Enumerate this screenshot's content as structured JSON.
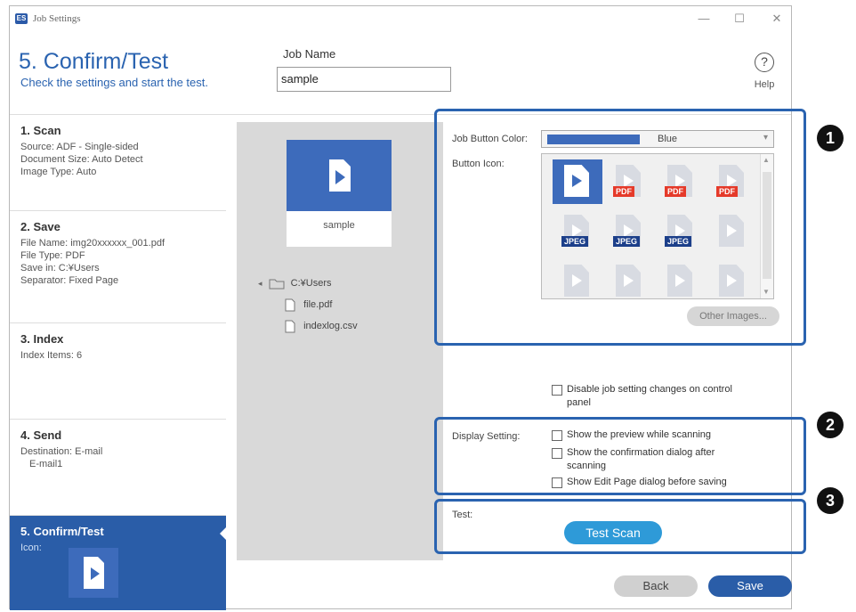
{
  "window": {
    "title": "Job Settings",
    "minimize": "—",
    "maximize": "☐",
    "close": "✕"
  },
  "header": {
    "title": "5. Confirm/Test",
    "subtitle": "Check the settings and start the test.",
    "job_name_label": "Job Name",
    "job_name_value": "sample",
    "help_label": "Help",
    "help_glyph": "?"
  },
  "sidebar": {
    "steps": [
      {
        "name": "1. Scan",
        "lines": [
          "Source: ADF - Single-sided",
          "Document Size: Auto Detect",
          "Image Type: Auto"
        ]
      },
      {
        "name": "2. Save",
        "lines": [
          "File Name: img20xxxxxx_001.pdf",
          "File Type: PDF",
          "Save in: C:¥Users",
          "Separator: Fixed Page"
        ]
      },
      {
        "name": "3. Index",
        "lines": [
          "Index Items: 6"
        ]
      },
      {
        "name": "4. Send",
        "lines": [
          "Destination: E-mail",
          "E-mail1"
        ]
      },
      {
        "name": "5. Confirm/Test",
        "lines": [
          "Icon:"
        ]
      }
    ]
  },
  "preview": {
    "tile_label": "sample",
    "tree": {
      "expand": "◂",
      "folder": "C:¥Users",
      "files": [
        "file.pdf",
        "indexlog.csv"
      ]
    }
  },
  "options": {
    "button_color_label": "Job Button Color:",
    "button_color_value": "Blue",
    "button_color_hex": "#3d6bbb",
    "button_icon_label": "Button Icon:",
    "icons": [
      {
        "name": "plain-icon",
        "tag": ""
      },
      {
        "name": "pdf-icon",
        "tag": "PDF"
      },
      {
        "name": "pdf-color-icon",
        "tag": "PDF"
      },
      {
        "name": "pdf-gray-icon",
        "tag": "PDF"
      },
      {
        "name": "jpeg-icon",
        "tag": "JPEG"
      },
      {
        "name": "jpeg-color-icon",
        "tag": "JPEG"
      },
      {
        "name": "jpeg-gray-icon",
        "tag": "JPEG"
      },
      {
        "name": "page-icon",
        "tag": ""
      },
      {
        "name": "image-icon",
        "tag": ""
      },
      {
        "name": "doc-icon",
        "tag": ""
      },
      {
        "name": "doc2-icon",
        "tag": ""
      },
      {
        "name": "doc3-icon",
        "tag": ""
      }
    ],
    "other_images_label": "Other Images...",
    "disable_changes_label_1": "Disable job setting changes on control",
    "disable_changes_label_2": "panel",
    "display_setting_label": "Display Setting:",
    "show_preview_label": "Show the preview while scanning",
    "show_confirm_label_1": "Show the confirmation dialog after",
    "show_confirm_label_2": "scanning",
    "show_edit_label": "Show Edit Page dialog before saving",
    "test_label": "Test:",
    "test_scan_label": "Test Scan"
  },
  "badges": [
    "1",
    "2",
    "3"
  ],
  "footer": {
    "back_label": "Back",
    "save_label": "Save"
  }
}
